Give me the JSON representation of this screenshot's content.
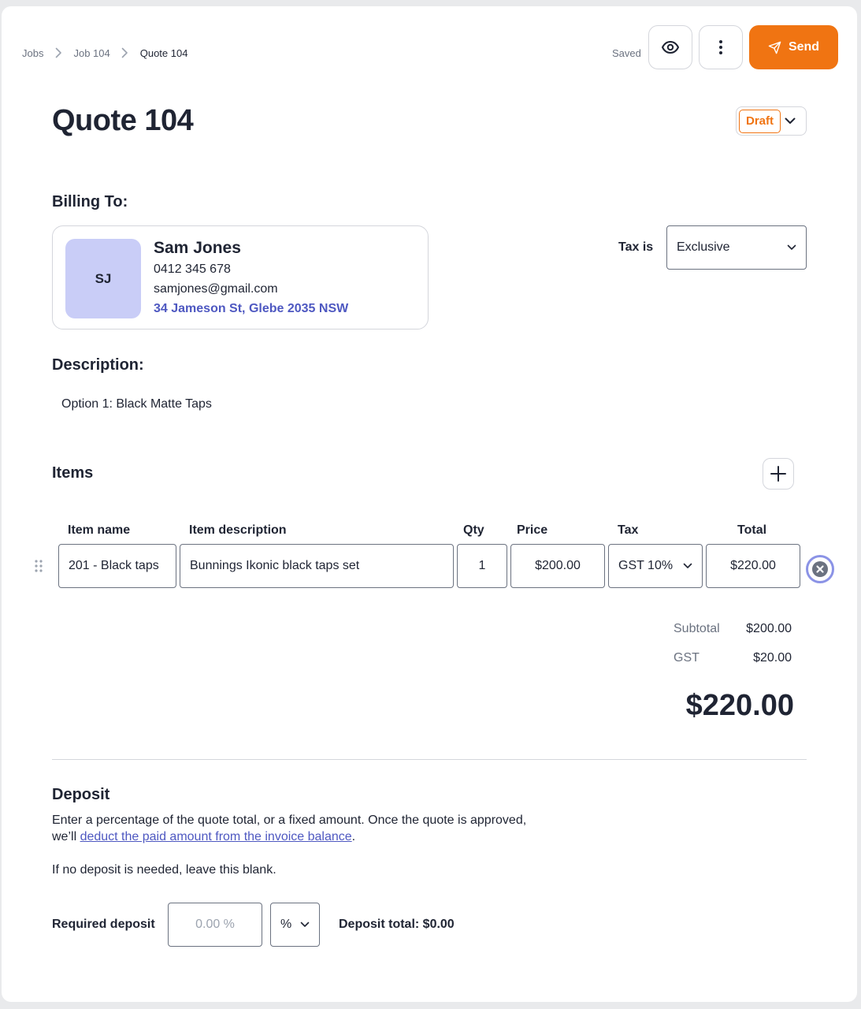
{
  "breadcrumb": {
    "items": [
      "Jobs",
      "Job 104",
      "Quote 104"
    ]
  },
  "header": {
    "saved_status": "Saved",
    "preview_icon": "eye-icon",
    "more_icon": "more-vertical-icon",
    "send_label": "Send",
    "send_icon": "paper-plane-icon",
    "accent_color": "#f07412"
  },
  "quote": {
    "title": "Quote 104",
    "status": "Draft"
  },
  "billing": {
    "heading": "Billing To:",
    "initials": "SJ",
    "name": "Sam Jones",
    "phone": "0412 345 678",
    "email": "samjones@gmail.com",
    "address": "34 Jameson St, Glebe 2035 NSW",
    "tax_label": "Tax is",
    "tax_value": "Exclusive"
  },
  "description": {
    "heading": "Description:",
    "text": "Option 1: Black Matte Taps"
  },
  "items": {
    "heading": "Items",
    "columns": [
      "Item name",
      "Item description",
      "Qty",
      "Price",
      "Tax",
      "Total"
    ],
    "rows": [
      {
        "name": "201 - Black taps",
        "description": "Bunnings Ikonic black taps set",
        "qty": "1",
        "price": "$200.00",
        "tax": "GST 10%",
        "total": "$220.00"
      }
    ]
  },
  "totals": {
    "subtotal_label": "Subtotal",
    "subtotal_value": "$200.00",
    "gst_label": "GST",
    "gst_value": "$20.00",
    "grand_total": "$220.00"
  },
  "deposit": {
    "heading": "Deposit",
    "text_before": "Enter a percentage of the quote total, or a fixed amount. Once the quote is approved,",
    "text_line2_prefix": "we’ll ",
    "link_text": "deduct the paid amount from the invoice balance",
    "text_line2_suffix": ".",
    "blank_note": "If no deposit is needed, leave this blank.",
    "required_label": "Required deposit",
    "input_placeholder": "0.00 %",
    "unit": "%",
    "total_text": "Deposit total: $0.00"
  }
}
